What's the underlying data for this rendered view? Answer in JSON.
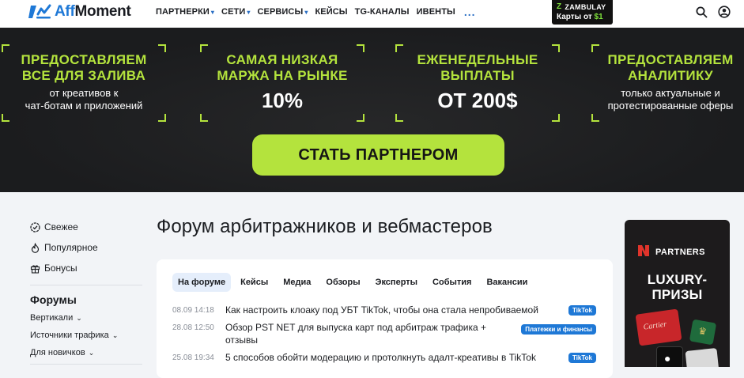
{
  "header": {
    "logo_prefix": "Aff",
    "logo_suffix": "Moment",
    "nav": [
      {
        "label": "ПАРТНЕРКИ",
        "has_dropdown": true
      },
      {
        "label": "СЕТИ",
        "has_dropdown": true
      },
      {
        "label": "СЕРВИСЫ",
        "has_dropdown": true
      },
      {
        "label": "КЕЙСЫ",
        "has_dropdown": false
      },
      {
        "label": "TG-КАНАЛЫ",
        "has_dropdown": false
      },
      {
        "label": "ИВЕНТЫ",
        "has_dropdown": false
      }
    ],
    "more": "...",
    "promo": {
      "brand": "ZAMBULAY",
      "text": "Карты от",
      "accent": "$1"
    },
    "icons": [
      "search-icon",
      "user-icon"
    ]
  },
  "banner": {
    "panels": [
      {
        "headline": "ПРЕДОСТАВЛЯЕМ\nВСЕ ДЛЯ ЗАЛИВА",
        "sub": "от креативов к\nчат-ботам и приложений",
        "big": ""
      },
      {
        "headline": "САМАЯ НИЗКАЯ\nМАРЖА НА РЫНКЕ",
        "sub": "",
        "big": "10%"
      },
      {
        "headline": "ЕЖЕНЕДЕЛЬНЫЕ\nВЫПЛАТЫ",
        "sub": "",
        "big": "ОТ 200$"
      },
      {
        "headline": "ПРЕДОСТАВЛЯЕМ\nАНАЛИТИКУ",
        "sub": "только актуальные и\nпротестированные оферы",
        "big": ""
      }
    ],
    "cta": "СТАТЬ ПАРТНЕРОМ",
    "accent_color": "#b4e33d"
  },
  "sidebar": {
    "links": [
      {
        "label": "Свежее",
        "icon": "check-badge-icon"
      },
      {
        "label": "Популярное",
        "icon": "fire-icon"
      },
      {
        "label": "Бонусы",
        "icon": "gift-icon"
      }
    ],
    "forums_heading": "Форумы",
    "sub_items": [
      "Вертикали",
      "Источники трафика",
      "Для новичков"
    ]
  },
  "main": {
    "title": "Форум арбитражников и вебмастеров",
    "tabs": [
      "На форуме",
      "Кейсы",
      "Медиа",
      "Обзоры",
      "Эксперты",
      "События",
      "Вакансии"
    ],
    "active_tab": "На форуме",
    "posts": [
      {
        "date": "08.09 14:18",
        "title": "Как настроить клоаку под УБТ TikTok, чтобы она стала непробиваемой",
        "tag": "TikTok"
      },
      {
        "date": "28.08 12:50",
        "title": "Обзор PST NET для выпуска карт под арбитраж трафика + отзывы",
        "tag": "Платежки и финансы"
      },
      {
        "date": "25.08 19:34",
        "title": "5 способов обойти модерацию и протолкнуть адалт-креативы в TikTok",
        "tag": "TikTok"
      }
    ]
  },
  "ad": {
    "brand": "PARTNERS",
    "headline": "LUXURY-\nПРИЗЫ",
    "item_label": "Cartier"
  }
}
